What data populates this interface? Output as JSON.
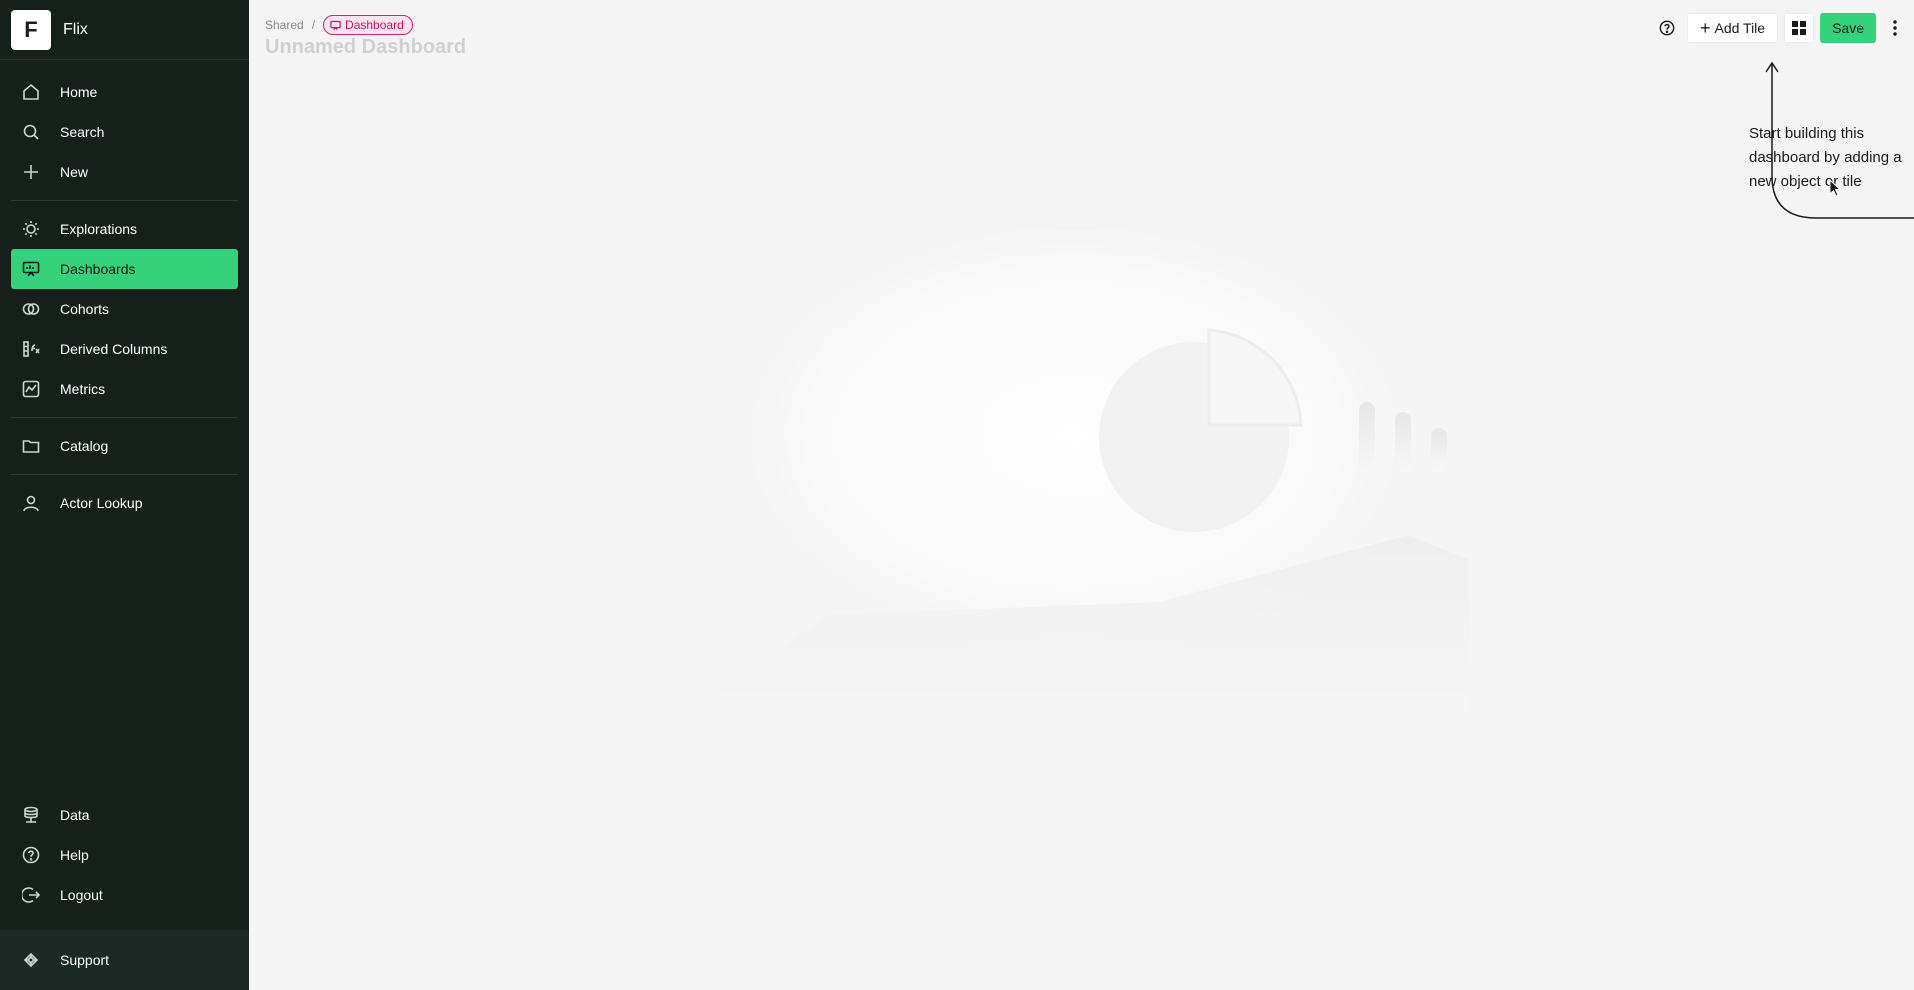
{
  "brand": {
    "logo_letter": "F",
    "name": "Flix"
  },
  "sidebar": {
    "primary": [
      {
        "label": "Home",
        "icon": "home-icon"
      },
      {
        "label": "Search",
        "icon": "search-icon"
      },
      {
        "label": "New",
        "icon": "plus-icon"
      }
    ],
    "analysis": [
      {
        "label": "Explorations",
        "icon": "lightbulb-icon"
      },
      {
        "label": "Dashboards",
        "icon": "dashboard-icon",
        "active": true
      },
      {
        "label": "Cohorts",
        "icon": "cohorts-icon"
      },
      {
        "label": "Derived Columns",
        "icon": "derived-columns-icon"
      },
      {
        "label": "Metrics",
        "icon": "metrics-icon"
      }
    ],
    "catalog": [
      {
        "label": "Catalog",
        "icon": "folder-icon"
      }
    ],
    "lookup": [
      {
        "label": "Actor Lookup",
        "icon": "user-icon"
      }
    ],
    "bottom": [
      {
        "label": "Data",
        "icon": "database-icon"
      },
      {
        "label": "Help",
        "icon": "help-icon"
      },
      {
        "label": "Logout",
        "icon": "logout-icon"
      }
    ],
    "support": {
      "label": "Support",
      "icon": "support-icon"
    }
  },
  "breadcrumb": {
    "parent": "Shared",
    "separator": "/",
    "current": "Dashboard"
  },
  "page": {
    "title": "Unnamed Dashboard"
  },
  "toolbar": {
    "help_icon": "help-circle-icon",
    "add_tile_label": "Add Tile",
    "grid_icon": "grid-layout-icon",
    "save_label": "Save",
    "more_icon": "more-vertical-icon"
  },
  "hint": {
    "text": "Start building this dashboard by adding a new object or tile"
  },
  "colors": {
    "sidebar_bg": "#15201b",
    "accent_green": "#34d27b",
    "badge_pink": "#d11f7a",
    "main_bg": "#f4f4f4"
  }
}
